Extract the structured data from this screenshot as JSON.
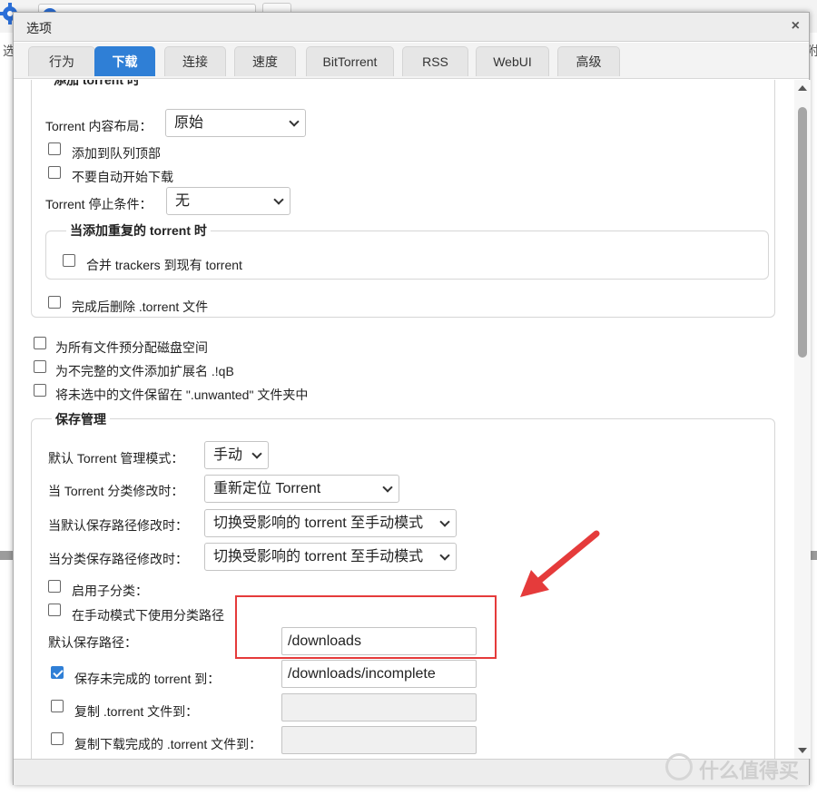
{
  "dialog": {
    "title": "选项",
    "close_glyph": "×"
  },
  "tabs": [
    {
      "label": "行为",
      "active": false
    },
    {
      "label": "下载",
      "active": true
    },
    {
      "label": "连接",
      "active": false
    },
    {
      "label": "速度",
      "active": false
    },
    {
      "label": "BitTorrent",
      "active": false
    },
    {
      "label": "RSS",
      "active": false
    },
    {
      "label": "WebUI",
      "active": false
    },
    {
      "label": "高级",
      "active": false
    }
  ],
  "add_torrent": {
    "legend": "添加 torrent 时",
    "layout_label": "Torrent 内容布局：",
    "layout_value": "原始",
    "add_top_label": "添加到队列顶部",
    "add_top_checked": false,
    "no_autostart_label": "不要自动开始下载",
    "no_autostart_checked": false,
    "stop_cond_label": "Torrent 停止条件：",
    "stop_cond_value": "无",
    "duplicate": {
      "legend": "当添加重复的 torrent 时",
      "merge_label": "合并 trackers 到现有 torrent",
      "merge_checked": false
    },
    "delete_label": "完成后删除 .torrent 文件",
    "delete_checked": false
  },
  "options": {
    "prealloc_label": "为所有文件预分配磁盘空间",
    "prealloc_checked": false,
    "append_ext_label": "为不完整的文件添加扩展名 .!qB",
    "append_ext_checked": false,
    "unwanted_label": "将未选中的文件保留在 \".unwanted\" 文件夹中",
    "unwanted_checked": false
  },
  "save_mgmt": {
    "legend": "保存管理",
    "mode_label": "默认 Torrent 管理模式：",
    "mode_value": "手动",
    "cat_changed_label": "当 Torrent 分类修改时：",
    "cat_changed_value": "重新定位 Torrent",
    "default_path_changed_label": "当默认保存路径修改时：",
    "default_path_changed_value": "切换受影响的 torrent 至手动模式",
    "cat_path_changed_label": "当分类保存路径修改时：",
    "cat_path_changed_value": "切换受影响的 torrent 至手动模式",
    "subcat_label": "启用子分类：",
    "subcat_checked": false,
    "use_cat_path_label": "在手动模式下使用分类路径",
    "use_cat_path_checked": false,
    "default_save_label": "默认保存路径：",
    "default_save_value": "/downloads",
    "incomplete_label": "保存未完成的 torrent 到：",
    "incomplete_checked": true,
    "incomplete_value": "/downloads/incomplete",
    "copy_torrent_label": "复制 .torrent 文件到：",
    "copy_torrent_checked": false,
    "copy_torrent_value": "",
    "copy_finished_label": "复制下载完成的 .torrent 文件到：",
    "copy_finished_checked": false,
    "copy_finished_value": ""
  },
  "annotation": {
    "highlight_color": "#e53b3b"
  },
  "background": {
    "left_char": "选",
    "right_char": "附"
  },
  "watermark": {
    "text": "什么值得买"
  }
}
